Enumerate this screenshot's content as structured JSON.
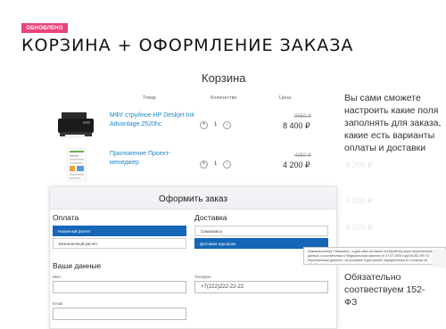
{
  "badge": "ОБНОВЛЕНО",
  "headline": "КОРЗИНА + ОФОРМЛЕНИЕ ЗАКАЗА",
  "cart": {
    "title": "Корзина",
    "columns": {
      "product": "Товар",
      "quantity": "Количество",
      "price": "Цена"
    },
    "items": [
      {
        "name": "МФУ струйное HP Deskjet Ink Advantage 2520hc",
        "qty": "1",
        "old_price": "9650 ₽",
        "price": "8 400 ₽",
        "ghost_price": ""
      },
      {
        "name": "Приложение Проект-менеджер",
        "qty": "1",
        "old_price": "4350 ₽",
        "price": "4 200 ₽",
        "ghost_price": "4 200 ₽"
      }
    ],
    "qty_minus": "-",
    "qty_plus": "+",
    "ghost_prices": [
      "4 200 ₽",
      "4 200 ₽",
      "4 200 ₽"
    ]
  },
  "side": {
    "text1": "Вы сами сможете настроить какие поля заполнять для заказа, какие есть варианты оплаты и доставки",
    "text2": "Обязательно соотвествуем 152-ФЗ"
  },
  "checkout": {
    "title": "Оформить заказ",
    "payment": {
      "label": "Оплата",
      "options": [
        "Наличный расчет",
        "Безналичный расчет"
      ],
      "selected": 0
    },
    "delivery": {
      "label": "Доставка",
      "options": [
        "Самовывоз",
        "Доставка курьером"
      ],
      "selected": 1
    },
    "your_data": "Ваши данные",
    "fields": {
      "name_label": "Имя",
      "name_value": "",
      "phone_label": "Телефон",
      "phone_value": "+7(222)222-22-22",
      "email_label": "Email",
      "email_value": ""
    },
    "tooltip": "Нажимая кнопку «Заказать», я даю свое согласие на обработку моих персональных данных, в соответствии с Федеральным законом от 27.07.2006 года №152-ФЗ «О персональных данных», на условиях и для целей, определенных в Согласии на обработку персональных данных"
  },
  "colors": {
    "accent": "#1566b7",
    "badge": "#e8457c",
    "link": "#1e88c7"
  }
}
